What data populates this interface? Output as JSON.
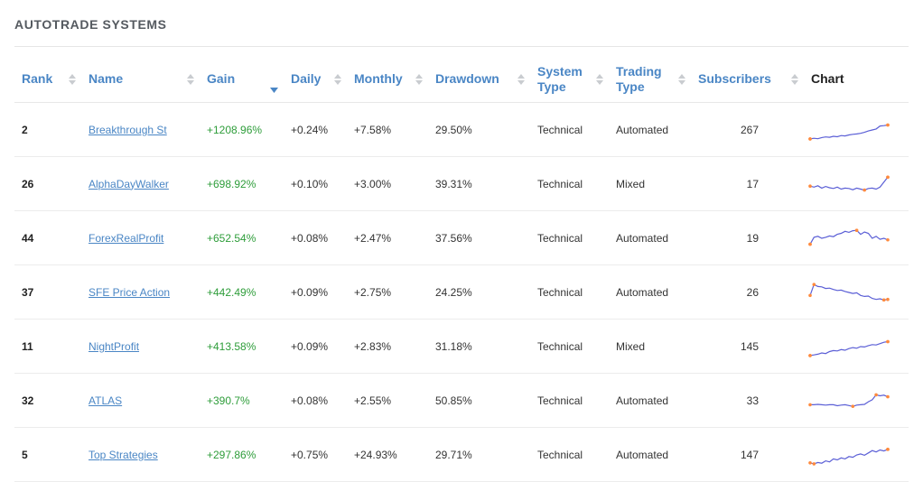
{
  "page": {
    "title": "AUTOTRADE SYSTEMS"
  },
  "table": {
    "headers": {
      "rank": "Rank",
      "name": "Name",
      "gain": "Gain",
      "daily": "Daily",
      "monthly": "Monthly",
      "drawdown": "Drawdown",
      "system_type": "System Type",
      "trading_type": "Trading Type",
      "subscribers": "Subscribers",
      "chart": "Chart"
    },
    "sorted_by": "gain",
    "sort_direction": "descending",
    "rows": [
      {
        "rank": "2",
        "name": "Breakthrough St",
        "gain": "+1208.96%",
        "daily": "+0.24%",
        "monthly": "+7.58%",
        "drawdown": "29.50%",
        "system_type": "Technical",
        "trading_type": "Automated",
        "subscribers": "267",
        "spark": [
          0.05,
          0.08,
          0.06,
          0.12,
          0.15,
          0.13,
          0.18,
          0.16,
          0.22,
          0.2,
          0.25,
          0.28,
          0.3,
          0.33,
          0.38,
          0.45,
          0.5,
          0.55,
          0.7,
          0.72,
          0.75
        ]
      },
      {
        "rank": "26",
        "name": "AlphaDayWalker",
        "gain": "+698.92%",
        "daily": "+0.10%",
        "monthly": "+3.00%",
        "drawdown": "39.31%",
        "system_type": "Technical",
        "trading_type": "Mixed",
        "subscribers": "17",
        "spark": [
          0.4,
          0.35,
          0.42,
          0.3,
          0.38,
          0.32,
          0.28,
          0.35,
          0.25,
          0.3,
          0.28,
          0.22,
          0.3,
          0.25,
          0.2,
          0.28,
          0.3,
          0.25,
          0.35,
          0.6,
          0.85
        ]
      },
      {
        "rank": "44",
        "name": "ForexRealProfit",
        "gain": "+652.54%",
        "daily": "+0.08%",
        "monthly": "+2.47%",
        "drawdown": "37.56%",
        "system_type": "Technical",
        "trading_type": "Automated",
        "subscribers": "19",
        "spark": [
          0.2,
          0.55,
          0.6,
          0.5,
          0.55,
          0.62,
          0.58,
          0.7,
          0.75,
          0.85,
          0.8,
          0.88,
          0.9,
          0.7,
          0.82,
          0.75,
          0.5,
          0.6,
          0.45,
          0.5,
          0.42
        ]
      },
      {
        "rank": "37",
        "name": "SFE Price Action",
        "gain": "+442.49%",
        "daily": "+0.09%",
        "monthly": "+2.75%",
        "drawdown": "24.25%",
        "system_type": "Technical",
        "trading_type": "Automated",
        "subscribers": "26",
        "spark": [
          0.35,
          0.9,
          0.8,
          0.78,
          0.7,
          0.72,
          0.65,
          0.6,
          0.62,
          0.55,
          0.5,
          0.45,
          0.48,
          0.35,
          0.3,
          0.32,
          0.2,
          0.15,
          0.18,
          0.12,
          0.15
        ]
      },
      {
        "rank": "11",
        "name": "NightProfit",
        "gain": "+413.58%",
        "daily": "+0.09%",
        "monthly": "+2.83%",
        "drawdown": "31.18%",
        "system_type": "Technical",
        "trading_type": "Mixed",
        "subscribers": "145",
        "spark": [
          0.05,
          0.08,
          0.12,
          0.18,
          0.15,
          0.25,
          0.3,
          0.28,
          0.35,
          0.32,
          0.4,
          0.45,
          0.42,
          0.5,
          0.48,
          0.55,
          0.6,
          0.58,
          0.65,
          0.72,
          0.75
        ]
      },
      {
        "rank": "32",
        "name": "ATLAS",
        "gain": "+390.7%",
        "daily": "+0.08%",
        "monthly": "+2.55%",
        "drawdown": "50.85%",
        "system_type": "Technical",
        "trading_type": "Automated",
        "subscribers": "33",
        "spark": [
          0.3,
          0.3,
          0.32,
          0.3,
          0.28,
          0.3,
          0.3,
          0.25,
          0.28,
          0.3,
          0.26,
          0.22,
          0.28,
          0.3,
          0.32,
          0.45,
          0.55,
          0.8,
          0.75,
          0.78,
          0.7
        ]
      },
      {
        "rank": "5",
        "name": "Top Strategies",
        "gain": "+297.86%",
        "daily": "+0.75%",
        "monthly": "+24.93%",
        "drawdown": "29.71%",
        "system_type": "Technical",
        "trading_type": "Automated",
        "subscribers": "147",
        "spark": [
          0.1,
          0.05,
          0.12,
          0.08,
          0.2,
          0.15,
          0.3,
          0.25,
          0.35,
          0.3,
          0.42,
          0.38,
          0.5,
          0.55,
          0.48,
          0.6,
          0.72,
          0.65,
          0.75,
          0.7,
          0.78
        ]
      }
    ]
  },
  "colors": {
    "link": "#4a86c5",
    "gain_positive": "#2e9d3a",
    "spark_line": "#5b5fd6",
    "spark_marker": "#ff8a3d"
  },
  "icons": {
    "sortable": "sort-arrows-icon",
    "sorted_desc": "sort-desc-icon"
  }
}
